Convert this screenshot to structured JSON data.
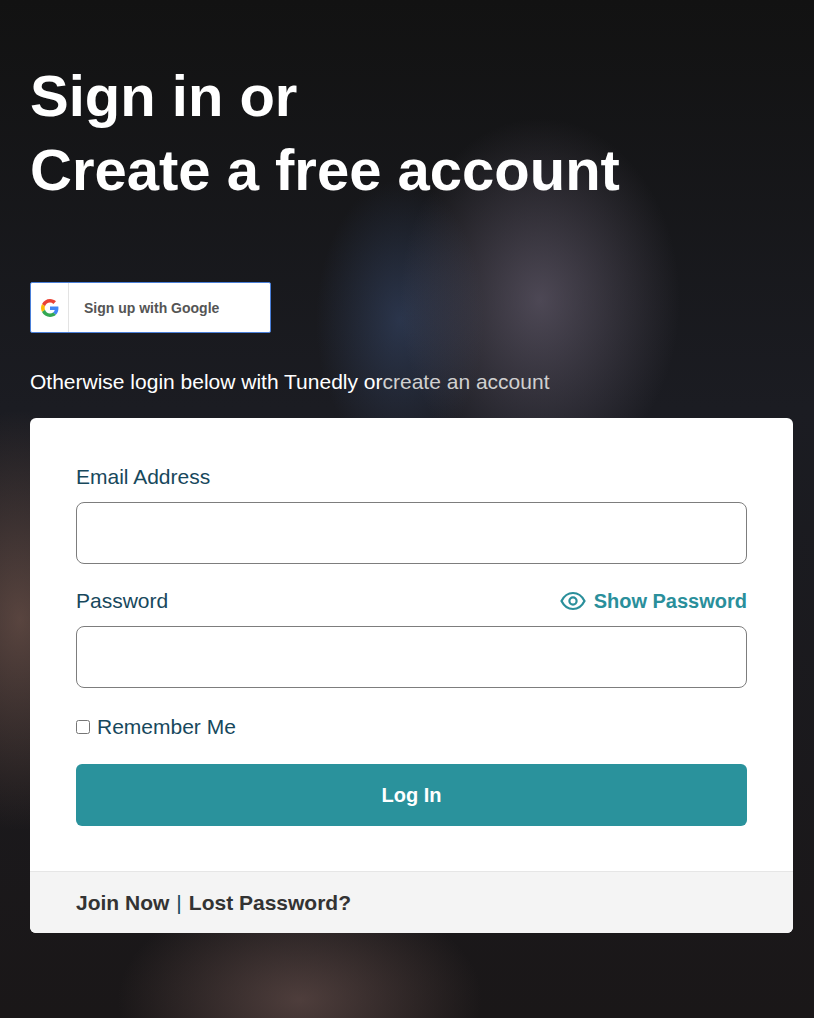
{
  "heading": {
    "line1": "Sign in or",
    "line2": "Create a free account"
  },
  "google_button": {
    "label": "Sign up with Google"
  },
  "intro": {
    "text": "Otherwise login below with Tunedly or",
    "link": "create an account"
  },
  "form": {
    "email": {
      "label": "Email Address",
      "value": ""
    },
    "password": {
      "label": "Password",
      "value": "",
      "show_label": "Show Password"
    },
    "remember": {
      "label": "Remember Me",
      "checked": false
    },
    "submit": "Log In"
  },
  "footer": {
    "join": "Join Now",
    "separator": "|",
    "lost": "Lost Password?"
  }
}
